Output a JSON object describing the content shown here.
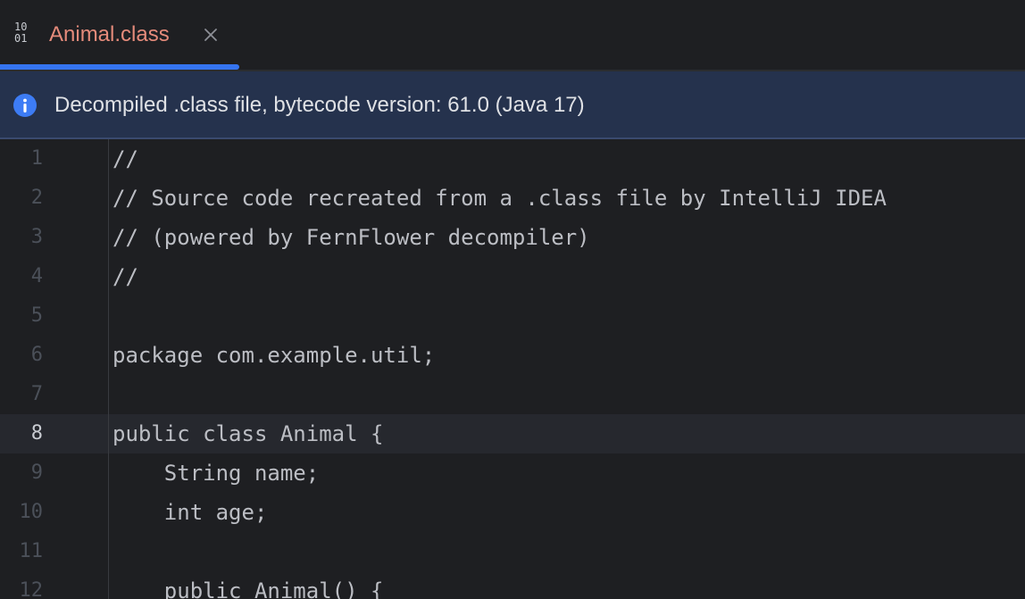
{
  "tab": {
    "icon_top": "10",
    "icon_bottom": "01",
    "title": "Animal.class"
  },
  "banner": {
    "icon": "info-icon",
    "text": "Decompiled .class file, bytecode version: 61.0 (Java 17)"
  },
  "editor": {
    "current_line": 8,
    "lines": [
      {
        "num": "1",
        "text": "//"
      },
      {
        "num": "2",
        "text": "// Source code recreated from a .class file by IntelliJ IDEA"
      },
      {
        "num": "3",
        "text": "// (powered by FernFlower decompiler)"
      },
      {
        "num": "4",
        "text": "//"
      },
      {
        "num": "5",
        "text": ""
      },
      {
        "num": "6",
        "text": "package com.example.util;"
      },
      {
        "num": "7",
        "text": ""
      },
      {
        "num": "8",
        "text": "public class Animal {"
      },
      {
        "num": "9",
        "text": "    String name;"
      },
      {
        "num": "10",
        "text": "    int age;"
      },
      {
        "num": "11",
        "text": ""
      },
      {
        "num": "12",
        "text": "    public Animal() {"
      }
    ]
  },
  "colors": {
    "tab_title": "#e58b7b",
    "accent": "#3574f0",
    "banner_bg": "#25324d",
    "editor_bg": "#1e1f22"
  }
}
